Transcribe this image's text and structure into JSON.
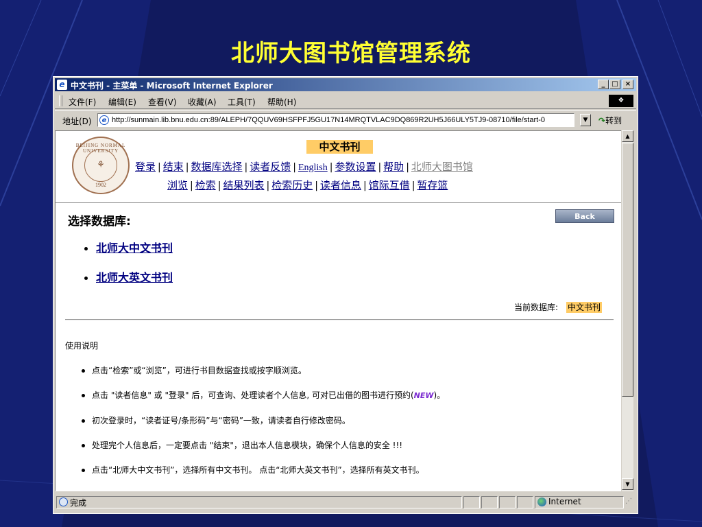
{
  "slide": {
    "title": "北师大图书馆管理系统"
  },
  "window": {
    "title": "中文书刊 - 主菜单 - Microsoft Internet Explorer",
    "controls": {
      "minimize": "_",
      "maximize": "□",
      "close": "×"
    }
  },
  "menu": [
    {
      "label": "文件(F)"
    },
    {
      "label": "编辑(E)"
    },
    {
      "label": "查看(V)"
    },
    {
      "label": "收藏(A)"
    },
    {
      "label": "工具(T)"
    },
    {
      "label": "帮助(H)"
    }
  ],
  "address": {
    "label": "地址(D)",
    "url": "http://sunmain.lib.bnu.edu.cn:89/ALEPH/7QQUV69HSFPFJ5GU17N14MRQTVLAC9DQ869R2UH5J66ULY5TJ9-08710/file/start-0",
    "go_label": "转到"
  },
  "page": {
    "seal": {
      "top_text": "BEIJING NORMAL UNIVERSITY",
      "year": "1902"
    },
    "current_db_badge": "中文书刊",
    "nav_row1": [
      {
        "label": "登录"
      },
      {
        "label": "结束"
      },
      {
        "label": "数据库选择"
      },
      {
        "label": "读者反馈"
      },
      {
        "label": "English"
      },
      {
        "label": "参数设置"
      },
      {
        "label": "帮助"
      },
      {
        "label": "北师大图书馆"
      }
    ],
    "nav_row2": [
      {
        "label": "浏览"
      },
      {
        "label": "检索"
      },
      {
        "label": "结果列表"
      },
      {
        "label": "检索历史"
      },
      {
        "label": "读者信息"
      },
      {
        "label": "馆际互借"
      },
      {
        "label": "暂存篮"
      }
    ],
    "section_title": "选择数据库:",
    "back_button": "Back",
    "databases": [
      {
        "label": "北师大中文书刊"
      },
      {
        "label": "北师大英文书刊"
      }
    ],
    "current_db": {
      "label": "当前数据库:",
      "value": "中文书刊"
    },
    "usage_title": "使用说明",
    "usage": [
      {
        "text": "点击“检索”或“浏览”，可进行书目数据查找或按字顺浏览。"
      },
      {
        "text": "点击 \"读者信息\" 或 \"登录\" 后，可查询、处理读者个人信息, 可对已出借的图书进行预约(",
        "badge": "NEW",
        "after": ")。"
      },
      {
        "text": "初次登录时，“读者证号/条形码”与“密码”一致，请读者自行修改密码。"
      },
      {
        "text": "处理完个人信息后，一定要点击  \"结束\"，退出本人信息模块，确保个人信息的安全  !!!"
      },
      {
        "text": "点击“北师大中文书刊”，选择所有中文书刊。  点击“北师大英文书刊”，选择所有英文书刊。"
      }
    ]
  },
  "status": {
    "text": "完成",
    "zone": "Internet"
  },
  "colors": {
    "slide_bg": "#111a5e",
    "title": "#ffff33",
    "highlight": "#ffcc66",
    "link": "#000080"
  }
}
